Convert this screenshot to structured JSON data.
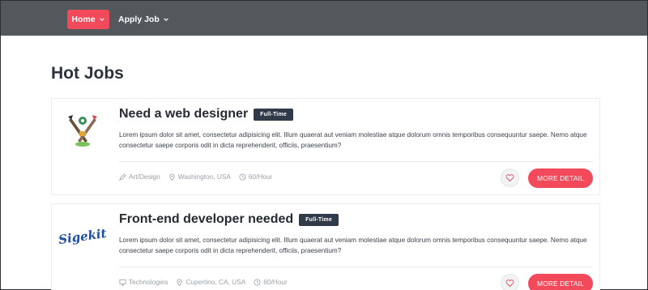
{
  "nav": {
    "home_label": "Home",
    "apply_label": "Apply Job",
    "accent_color": "#f24a5a",
    "bar_color": "#53585d"
  },
  "page": {
    "title": "Hot Jobs"
  },
  "jobs": [
    {
      "title": "Need a web designer",
      "badge": "Full-Time",
      "description": "Lorem ipsum dolor sit amet, consectetur adipisicing elit. Illum quaerat aut veniam molestiae atque dolorum omnis temporibus consequuntur saepe. Nemo atque consectetur saepe corporis odit in dicta reprehenderit, officiis, praesentium?",
      "category": "Art/Design",
      "location": "Washington, USA",
      "rate": "60/Hour",
      "button_label": "MORE DETAIL",
      "logo_icon": "pen-brush-logo-icon"
    },
    {
      "title": "Front-end developer needed",
      "badge": "Full-Time",
      "description": "Lorem ipsum dolor sit amet, consectetur adipisicing elit. Illum quaerat aut veniam molestiae atque dolorum omnis temporibus consequuntur saepe. Nemo atque consectetur saepe corporis odit in dicta reprehenderit, officiis, praesentium?",
      "category": "Technologies",
      "location": "Cupertino, CA, USA",
      "rate": "60/Hour",
      "button_label": "MORE DETAIL",
      "logo_text": "Sigekit"
    }
  ]
}
